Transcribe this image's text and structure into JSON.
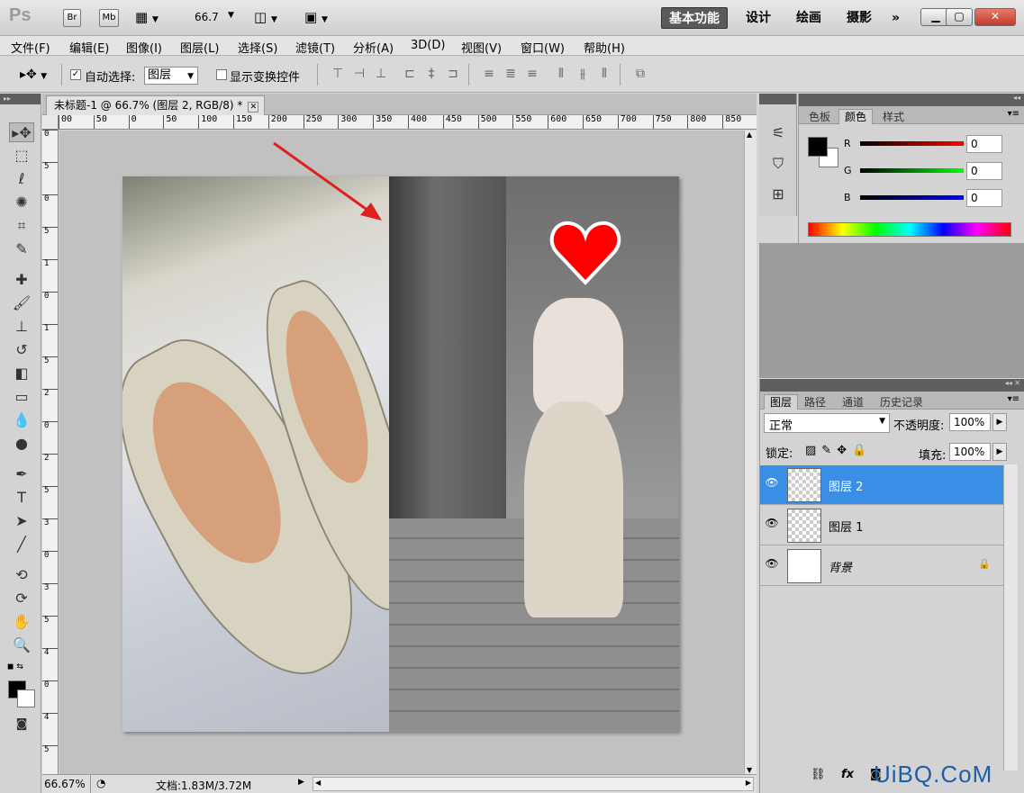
{
  "app": {
    "logo": "Ps",
    "br_label": "Br",
    "mb_label": "Mb",
    "zoom_display": "66.7"
  },
  "workspaces": [
    "基本功能",
    "设计",
    "绘画",
    "摄影"
  ],
  "workspaces_more": "»",
  "menu": [
    "文件(F)",
    "编辑(E)",
    "图像(I)",
    "图层(L)",
    "选择(S)",
    "滤镜(T)",
    "分析(A)",
    "3D(D)",
    "视图(V)",
    "窗口(W)",
    "帮助(H)"
  ],
  "options": {
    "auto_select_label": "自动选择:",
    "auto_select_checked": true,
    "auto_select_value": "图层",
    "show_transform_label": "显示变换控件"
  },
  "document": {
    "tab_title": "未标题-1 @ 66.7% (图层 2, RGB/8) *",
    "ruler_h": [
      "00",
      "50",
      "0",
      "50",
      "100",
      "150",
      "200",
      "250",
      "300",
      "350",
      "400",
      "450",
      "500",
      "550",
      "600",
      "650",
      "700",
      "750",
      "800",
      "850"
    ],
    "ruler_v": [
      "0",
      "5",
      "0",
      "5",
      "1",
      "0",
      "1",
      "5",
      "2",
      "0",
      "2",
      "5",
      "3",
      "0",
      "3",
      "5",
      "4",
      "0",
      "4",
      "5"
    ],
    "status_zoom": "66.67%",
    "status_info": "文档:1.83M/3.72M"
  },
  "color_panel": {
    "tabs": [
      "色板",
      "颜色",
      "样式"
    ],
    "active_tab": "颜色",
    "channels": [
      {
        "label": "R",
        "value": "0",
        "gradient": "linear-gradient(90deg,#000,#ff0000)"
      },
      {
        "label": "G",
        "value": "0",
        "gradient": "linear-gradient(90deg,#000,#00ff00)"
      },
      {
        "label": "B",
        "value": "0",
        "gradient": "linear-gradient(90deg,#000,#0000ff)"
      }
    ],
    "foreground": "#000000",
    "background": "#ffffff"
  },
  "layers_panel": {
    "tabs": [
      "图层",
      "路径",
      "通道",
      "历史记录"
    ],
    "active_tab": "图层",
    "blend_mode": "正常",
    "opacity_label": "不透明度:",
    "opacity_value": "100%",
    "lock_label": "锁定:",
    "fill_label": "填充:",
    "fill_value": "100%",
    "layers": [
      {
        "name": "图层 2",
        "selected": true
      },
      {
        "name": "图层 1",
        "selected": false
      },
      {
        "name": "背景",
        "selected": false,
        "locked": true
      }
    ]
  },
  "watermark": "UiBQ.CoM",
  "accent_color": "#3a8ee6"
}
